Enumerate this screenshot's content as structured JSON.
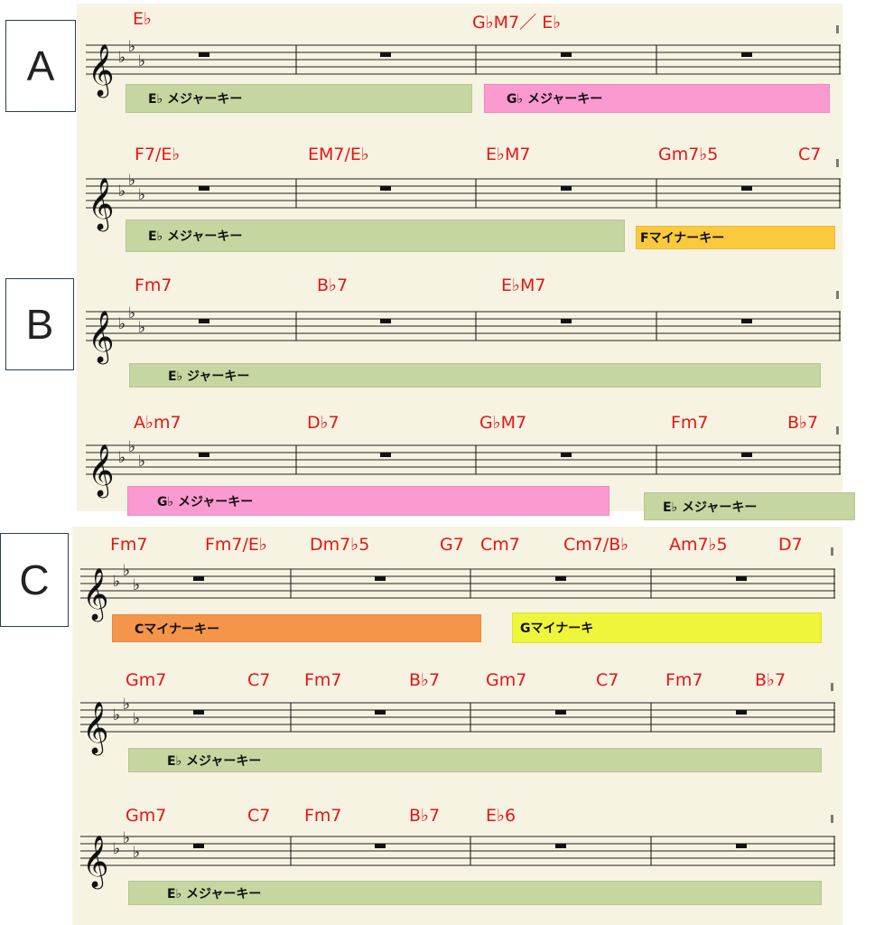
{
  "sections": [
    {
      "id": "A",
      "label": "A",
      "systems": [
        {
          "chords": [
            "E♭",
            "G♭M7／ E♭"
          ],
          "keys": [
            {
              "label": "E♭ メジャーキー",
              "color": "#c5d6a0"
            },
            {
              "label": "G♭ メジャーキー",
              "color": "#fb9ad0"
            }
          ]
        },
        {
          "chords": [
            "F7/E♭",
            "EM7/E♭",
            "E♭M7",
            "Gm7♭5",
            "C7"
          ],
          "keys": [
            {
              "label": "E♭ メジャーキー",
              "color": "#c5d6a0"
            },
            {
              "label": "Fマイナーキー",
              "color": "#fbc93d"
            }
          ]
        }
      ]
    },
    {
      "id": "B",
      "label": "B",
      "systems": [
        {
          "chords": [
            "Fm7",
            "B♭7",
            "E♭M7"
          ],
          "keys": [
            {
              "label": "E♭ ジャーキー",
              "color": "#c5d6a0"
            }
          ]
        },
        {
          "chords": [
            "A♭m7",
            "D♭7",
            "G♭M7",
            "Fm7",
            "B♭7"
          ],
          "keys": [
            {
              "label": "G♭ メジャーキー",
              "color": "#fb9ad0"
            },
            {
              "label": "E♭ メジャーキー",
              "color": "#c5d6a0"
            }
          ]
        }
      ]
    },
    {
      "id": "C",
      "label": "C",
      "systems": [
        {
          "chords": [
            "Fm7",
            "Fm7/E♭",
            "Dm7♭5",
            "G7",
            "Cm7",
            "Cm7/B♭",
            "Am7♭5",
            "D7"
          ],
          "keys": [
            {
              "label": "Cマイナーキー",
              "color": "#f5954a"
            },
            {
              "label": "Gマイナーキ",
              "color": "#eef53a"
            }
          ]
        },
        {
          "chords": [
            "Gm7",
            "C7",
            "Fm7",
            "B♭7",
            "Gm7",
            "C7",
            "Fm7",
            "B♭7"
          ],
          "keys": [
            {
              "label": "E♭ メジャーキー",
              "color": "#c5d6a0"
            }
          ]
        },
        {
          "chords": [
            "Gm7",
            "C7",
            "Fm7",
            "B♭7",
            "E♭6"
          ],
          "keys": [
            {
              "label": "E♭ メジャーキー",
              "color": "#c5d6a0"
            }
          ]
        }
      ]
    }
  ]
}
